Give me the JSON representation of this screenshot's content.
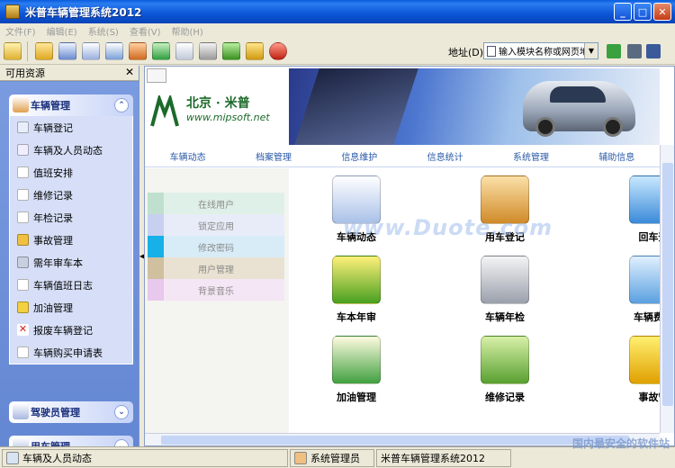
{
  "window": {
    "title": "米普车辆管理系统2012",
    "buttons": [
      "_",
      "□",
      "✕"
    ]
  },
  "menu": [
    "文件(F)",
    "编辑(E)",
    "系统(S)",
    "查看(V)",
    "帮助(H)"
  ],
  "toolbar": {
    "icons": [
      "nav-icon",
      "folder-icon",
      "grid-icon",
      "org-icon",
      "card-icon",
      "home-icon",
      "refresh-icon",
      "mail-icon",
      "print-icon",
      "user-icon",
      "key-icon",
      "exit-icon"
    ],
    "address_label": "地址(D)",
    "address_value": "输入模块名称或网页地"
  },
  "left_panel": {
    "title": "可用资源",
    "groups": [
      {
        "title": "车辆管理",
        "items": [
          "车辆登记",
          "车辆及人员动态",
          "值班安排",
          "维修记录",
          "年检记录",
          "事故管理",
          "需年审车本",
          "车辆值班日志",
          "加油管理",
          "报废车辆登记",
          "车辆购买申请表"
        ]
      },
      {
        "title": "驾驶员管理"
      },
      {
        "title": "用车管理"
      }
    ]
  },
  "banner": {
    "logo_cn": "北京 · 米普",
    "logo_url": "www.mipsoft.net"
  },
  "top_nav": [
    "车辆动态",
    "档案管理",
    "信息维护",
    "信息统计",
    "系统管理",
    "辅助信息"
  ],
  "side_menu": [
    "在线用户",
    "锁定应用",
    "修改密码",
    "用户管理",
    "背景音乐"
  ],
  "tiles": [
    "车辆动态",
    "用车登记",
    "回车登",
    "车本年审",
    "车辆年检",
    "车辆费用",
    "加油管理",
    "维修记录",
    "事故管"
  ],
  "watermark": "www.Duote.com",
  "status": {
    "module": "车辆及人员动态",
    "user": "系统管理员",
    "app": "米普车辆管理系统2012",
    "site_mark": "国内最安全的软件站"
  }
}
